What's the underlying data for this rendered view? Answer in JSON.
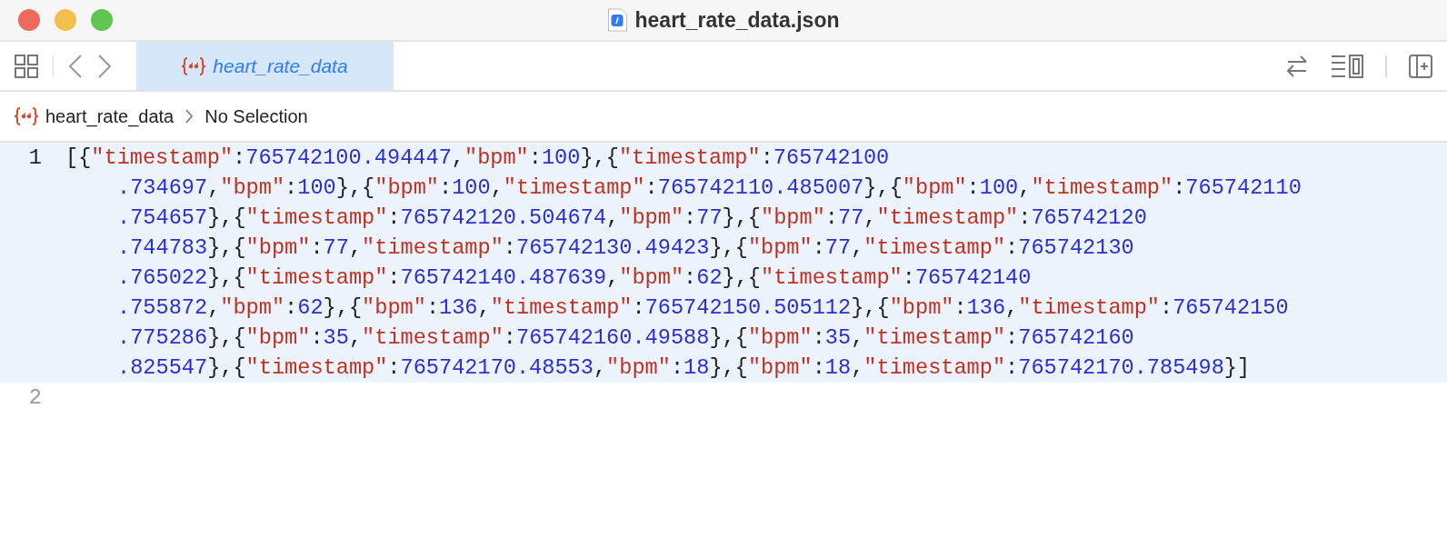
{
  "window": {
    "title": "heart_rate_data.json"
  },
  "toolbar": {
    "tabs": [
      {
        "label": "heart_rate_data",
        "selected": true
      }
    ]
  },
  "breadcrumb": [
    "heart_rate_data",
    "No Selection"
  ],
  "editor": {
    "lines": [
      {
        "number": "1",
        "current": true,
        "rows": [
          "[{\"timestamp\":765742100.494447,\"bpm\":100},{\"timestamp\":765742100",
          ".734697,\"bpm\":100},{\"bpm\":100,\"timestamp\":765742110.485007},{\"bpm\":100,\"timestamp\":765742110",
          ".754657},{\"timestamp\":765742120.504674,\"bpm\":77},{\"bpm\":77,\"timestamp\":765742120",
          ".744783},{\"bpm\":77,\"timestamp\":765742130.49423},{\"bpm\":77,\"timestamp\":765742130",
          ".765022},{\"timestamp\":765742140.487639,\"bpm\":62},{\"timestamp\":765742140",
          ".755872,\"bpm\":62},{\"bpm\":136,\"timestamp\":765742150.505112},{\"bpm\":136,\"timestamp\":765742150",
          ".775286},{\"bpm\":35,\"timestamp\":765742160.49588},{\"bpm\":35,\"timestamp\":765742160",
          ".825547},{\"timestamp\":765742170.48553,\"bpm\":18},{\"bpm\":18,\"timestamp\":765742170.785498}]"
        ]
      },
      {
        "number": "2",
        "current": false
      }
    ]
  }
}
